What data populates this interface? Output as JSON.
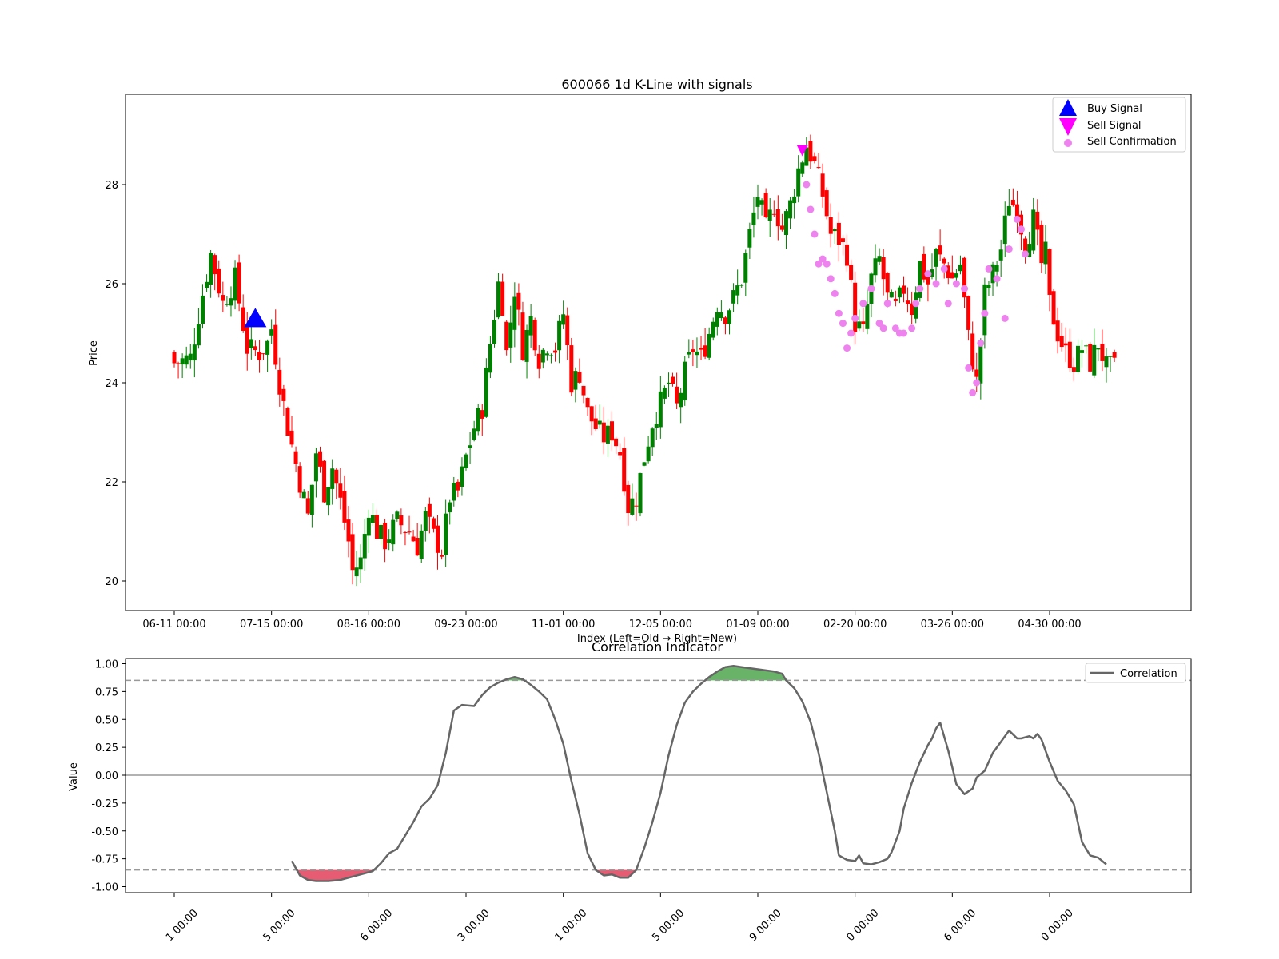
{
  "chart_data": [
    {
      "type": "candlestick",
      "title": "600066 1d K-Line with signals",
      "xlabel": "Index (Left=Old → Right=New)",
      "ylabel": "Price",
      "ylim": [
        19.4,
        29.8
      ],
      "yticks": [
        20,
        22,
        24,
        26,
        28
      ],
      "xticks": [
        {
          "index": 0,
          "label": "06-11 00:00"
        },
        {
          "index": 24,
          "label": "07-15 00:00"
        },
        {
          "index": 48,
          "label": "08-16 00:00"
        },
        {
          "index": 72,
          "label": "09-23 00:00"
        },
        {
          "index": 96,
          "label": "11-01 00:00"
        },
        {
          "index": 120,
          "label": "12-05 00:00"
        },
        {
          "index": 144,
          "label": "01-09 00:00"
        },
        {
          "index": 168,
          "label": "02-20 00:00"
        },
        {
          "index": 192,
          "label": "03-26 00:00"
        },
        {
          "index": 216,
          "label": "04-30 00:00"
        }
      ],
      "close_anchors": [
        [
          0,
          24.4
        ],
        [
          4,
          24.5
        ],
        [
          7,
          25.8
        ],
        [
          9,
          26.6
        ],
        [
          12,
          25.6
        ],
        [
          15,
          26.1
        ],
        [
          18,
          24.7
        ],
        [
          21,
          24.6
        ],
        [
          23,
          24.8
        ],
        [
          24,
          25.1
        ],
        [
          26,
          24.0
        ],
        [
          28,
          23.1
        ],
        [
          31,
          22.0
        ],
        [
          33,
          21.3
        ],
        [
          35,
          22.6
        ],
        [
          37,
          21.8
        ],
        [
          39,
          22.3
        ],
        [
          41,
          21.6
        ],
        [
          43,
          20.8
        ],
        [
          44,
          20.2
        ],
        [
          46,
          20.4
        ],
        [
          48,
          21.5
        ],
        [
          50,
          21.0
        ],
        [
          52,
          20.8
        ],
        [
          55,
          21.2
        ],
        [
          58,
          21.0
        ],
        [
          60,
          20.7
        ],
        [
          62,
          21.3
        ],
        [
          64,
          20.9
        ],
        [
          66,
          20.6
        ],
        [
          68,
          21.7
        ],
        [
          70,
          21.8
        ],
        [
          72,
          22.5
        ],
        [
          74,
          23.1
        ],
        [
          76,
          23.5
        ],
        [
          78,
          24.8
        ],
        [
          80,
          26.0
        ],
        [
          81,
          25.6
        ],
        [
          82,
          24.6
        ],
        [
          84,
          25.9
        ],
        [
          86,
          24.7
        ],
        [
          88,
          25.3
        ],
        [
          90,
          24.5
        ],
        [
          92,
          24.8
        ],
        [
          94,
          24.7
        ],
        [
          96,
          25.4
        ],
        [
          98,
          24.0
        ],
        [
          100,
          24.2
        ],
        [
          102,
          23.4
        ],
        [
          104,
          23.1
        ],
        [
          106,
          22.9
        ],
        [
          108,
          23.0
        ],
        [
          110,
          22.6
        ],
        [
          112,
          21.5
        ],
        [
          114,
          21.7
        ],
        [
          116,
          22.5
        ],
        [
          118,
          23.2
        ],
        [
          120,
          23.6
        ],
        [
          122,
          24.0
        ],
        [
          124,
          23.5
        ],
        [
          126,
          24.2
        ],
        [
          128,
          24.7
        ],
        [
          130,
          24.5
        ],
        [
          132,
          25.0
        ],
        [
          134,
          25.6
        ],
        [
          136,
          25.4
        ],
        [
          138,
          25.7
        ],
        [
          140,
          26.1
        ],
        [
          142,
          27.0
        ],
        [
          144,
          27.8
        ],
        [
          146,
          27.1
        ],
        [
          148,
          27.6
        ],
        [
          150,
          27.1
        ],
        [
          152,
          27.6
        ],
        [
          154,
          28.3
        ],
        [
          156,
          28.8
        ],
        [
          158,
          28.4
        ],
        [
          160,
          27.8
        ],
        [
          162,
          27.0
        ],
        [
          164,
          26.9
        ],
        [
          166,
          26.6
        ],
        [
          167,
          25.9
        ],
        [
          168,
          25.2
        ],
        [
          170,
          25.0
        ],
        [
          172,
          26.1
        ],
        [
          174,
          26.5
        ],
        [
          176,
          25.7
        ],
        [
          178,
          25.5
        ],
        [
          180,
          25.9
        ],
        [
          182,
          25.5
        ],
        [
          184,
          26.4
        ],
        [
          186,
          26.0
        ],
        [
          188,
          26.6
        ],
        [
          190,
          26.4
        ],
        [
          192,
          26.1
        ],
        [
          194,
          26.4
        ],
        [
          196,
          24.9
        ],
        [
          198,
          24.0
        ],
        [
          200,
          25.8
        ],
        [
          202,
          26.2
        ],
        [
          204,
          26.7
        ],
        [
          206,
          27.7
        ],
        [
          208,
          27.5
        ],
        [
          210,
          26.8
        ],
        [
          212,
          27.3
        ],
        [
          214,
          26.4
        ],
        [
          215,
          26.6
        ],
        [
          216,
          25.6
        ],
        [
          218,
          25.0
        ],
        [
          220,
          24.6
        ],
        [
          222,
          24.4
        ],
        [
          224,
          24.7
        ],
        [
          226,
          24.4
        ],
        [
          228,
          24.8
        ],
        [
          230,
          24.3
        ],
        [
          232,
          24.3
        ]
      ],
      "buy_signals": [
        {
          "index": 20,
          "price": 25.3
        }
      ],
      "sell_signals": [
        {
          "index": 155,
          "price": 28.7
        }
      ],
      "sell_confirmations": [
        [
          156,
          28.0
        ],
        [
          157,
          27.5
        ],
        [
          158,
          27.0
        ],
        [
          159,
          26.4
        ],
        [
          160,
          26.5
        ],
        [
          161,
          26.4
        ],
        [
          162,
          26.1
        ],
        [
          163,
          25.8
        ],
        [
          164,
          25.4
        ],
        [
          165,
          25.2
        ],
        [
          166,
          24.7
        ],
        [
          167,
          25.0
        ],
        [
          168,
          25.3
        ],
        [
          170,
          25.6
        ],
        [
          172,
          25.9
        ],
        [
          174,
          25.2
        ],
        [
          175,
          25.1
        ],
        [
          176,
          25.6
        ],
        [
          178,
          25.1
        ],
        [
          179,
          25.0
        ],
        [
          180,
          25.0
        ],
        [
          182,
          25.1
        ],
        [
          183,
          25.6
        ],
        [
          184,
          25.9
        ],
        [
          186,
          26.2
        ],
        [
          188,
          26.0
        ],
        [
          190,
          26.3
        ],
        [
          191,
          25.6
        ],
        [
          193,
          26.0
        ],
        [
          195,
          25.9
        ],
        [
          196,
          24.3
        ],
        [
          197,
          23.8
        ],
        [
          198,
          24.0
        ],
        [
          199,
          24.8
        ],
        [
          200,
          25.4
        ],
        [
          201,
          26.3
        ],
        [
          203,
          26.1
        ],
        [
          205,
          25.3
        ],
        [
          206,
          26.7
        ],
        [
          208,
          27.3
        ],
        [
          209,
          27.1
        ],
        [
          210,
          26.6
        ]
      ],
      "up_color": "#008000",
      "down_color": "#ff0000",
      "legend": {
        "placement": "top-right",
        "entries": [
          {
            "label": "Buy Signal",
            "marker": "triangle-up",
            "color": "#0000ff"
          },
          {
            "label": "Sell Signal",
            "marker": "triangle-down",
            "color": "#ff00ff"
          },
          {
            "label": "Sell Confirmation",
            "marker": "circle",
            "color": "#ee82ee"
          }
        ]
      }
    },
    {
      "type": "line",
      "title": "Correlation Indicator",
      "xlabel": "",
      "ylabel": "Value",
      "ylim": [
        -1.05,
        1.05
      ],
      "yticks": [
        -1.0,
        -0.75,
        -0.5,
        -0.25,
        0.0,
        0.25,
        0.5,
        0.75,
        1.0
      ],
      "xticks_truncated": [
        "1 00:00",
        "5 00:00",
        "6 00:00",
        "3 00:00",
        "1 00:00",
        "5 00:00",
        "9 00:00",
        "0 00:00",
        "6 00:00",
        "0 00:00"
      ],
      "upper_threshold": 0.85,
      "lower_threshold": -0.85,
      "line_color": "#666666",
      "fill_above_color": "#4da64d",
      "fill_below_color": "#e0405a",
      "series": [
        {
          "name": "Correlation",
          "points": [
            [
              29,
              -0.77
            ],
            [
              31,
              -0.9
            ],
            [
              33,
              -0.94
            ],
            [
              35,
              -0.95
            ],
            [
              38,
              -0.95
            ],
            [
              41,
              -0.94
            ],
            [
              44,
              -0.91
            ],
            [
              47,
              -0.88
            ],
            [
              49,
              -0.86
            ],
            [
              51,
              -0.79
            ],
            [
              53,
              -0.7
            ],
            [
              55,
              -0.66
            ],
            [
              57,
              -0.54
            ],
            [
              59,
              -0.42
            ],
            [
              61,
              -0.28
            ],
            [
              63,
              -0.21
            ],
            [
              65,
              -0.09
            ],
            [
              67,
              0.2
            ],
            [
              69,
              0.58
            ],
            [
              71,
              0.63
            ],
            [
              74,
              0.62
            ],
            [
              76,
              0.72
            ],
            [
              78,
              0.79
            ],
            [
              80,
              0.83
            ],
            [
              82,
              0.86
            ],
            [
              84,
              0.88
            ],
            [
              86,
              0.86
            ],
            [
              88,
              0.81
            ],
            [
              90,
              0.75
            ],
            [
              92,
              0.68
            ],
            [
              94,
              0.5
            ],
            [
              96,
              0.28
            ],
            [
              98,
              -0.05
            ],
            [
              100,
              -0.35
            ],
            [
              102,
              -0.7
            ],
            [
              104,
              -0.85
            ],
            [
              106,
              -0.9
            ],
            [
              108,
              -0.89
            ],
            [
              110,
              -0.92
            ],
            [
              112,
              -0.92
            ],
            [
              114,
              -0.85
            ],
            [
              116,
              -0.65
            ],
            [
              118,
              -0.42
            ],
            [
              120,
              -0.16
            ],
            [
              122,
              0.18
            ],
            [
              124,
              0.45
            ],
            [
              126,
              0.65
            ],
            [
              128,
              0.75
            ],
            [
              130,
              0.82
            ],
            [
              132,
              0.88
            ],
            [
              134,
              0.93
            ],
            [
              136,
              0.97
            ],
            [
              138,
              0.98
            ],
            [
              140,
              0.97
            ],
            [
              142,
              0.96
            ],
            [
              144,
              0.95
            ],
            [
              146,
              0.94
            ],
            [
              148,
              0.93
            ],
            [
              150,
              0.91
            ],
            [
              151,
              0.85
            ],
            [
              153,
              0.78
            ],
            [
              155,
              0.66
            ],
            [
              157,
              0.48
            ],
            [
              159,
              0.2
            ],
            [
              161,
              -0.15
            ],
            [
              163,
              -0.5
            ],
            [
              164,
              -0.72
            ],
            [
              166,
              -0.76
            ],
            [
              168,
              -0.77
            ],
            [
              169,
              -0.72
            ],
            [
              170,
              -0.79
            ],
            [
              172,
              -0.8
            ],
            [
              174,
              -0.78
            ],
            [
              176,
              -0.75
            ],
            [
              177,
              -0.69
            ],
            [
              179,
              -0.5
            ],
            [
              180,
              -0.3
            ],
            [
              182,
              -0.07
            ],
            [
              184,
              0.12
            ],
            [
              186,
              0.27
            ],
            [
              187,
              0.33
            ],
            [
              188,
              0.42
            ],
            [
              189,
              0.47
            ],
            [
              191,
              0.22
            ],
            [
              193,
              -0.08
            ],
            [
              195,
              -0.17
            ],
            [
              197,
              -0.12
            ],
            [
              198,
              -0.02
            ],
            [
              200,
              0.04
            ],
            [
              202,
              0.2
            ],
            [
              204,
              0.3
            ],
            [
              206,
              0.4
            ],
            [
              208,
              0.33
            ],
            [
              209,
              0.33
            ],
            [
              211,
              0.35
            ],
            [
              212,
              0.33
            ],
            [
              213,
              0.37
            ],
            [
              214,
              0.32
            ],
            [
              216,
              0.12
            ],
            [
              218,
              -0.05
            ],
            [
              220,
              -0.14
            ],
            [
              222,
              -0.26
            ],
            [
              224,
              -0.6
            ],
            [
              226,
              -0.72
            ],
            [
              228,
              -0.74
            ],
            [
              230,
              -0.8
            ]
          ]
        }
      ],
      "legend": {
        "placement": "top-right",
        "entries": [
          {
            "label": "Correlation",
            "marker": "line",
            "color": "#666666"
          }
        ]
      }
    }
  ]
}
